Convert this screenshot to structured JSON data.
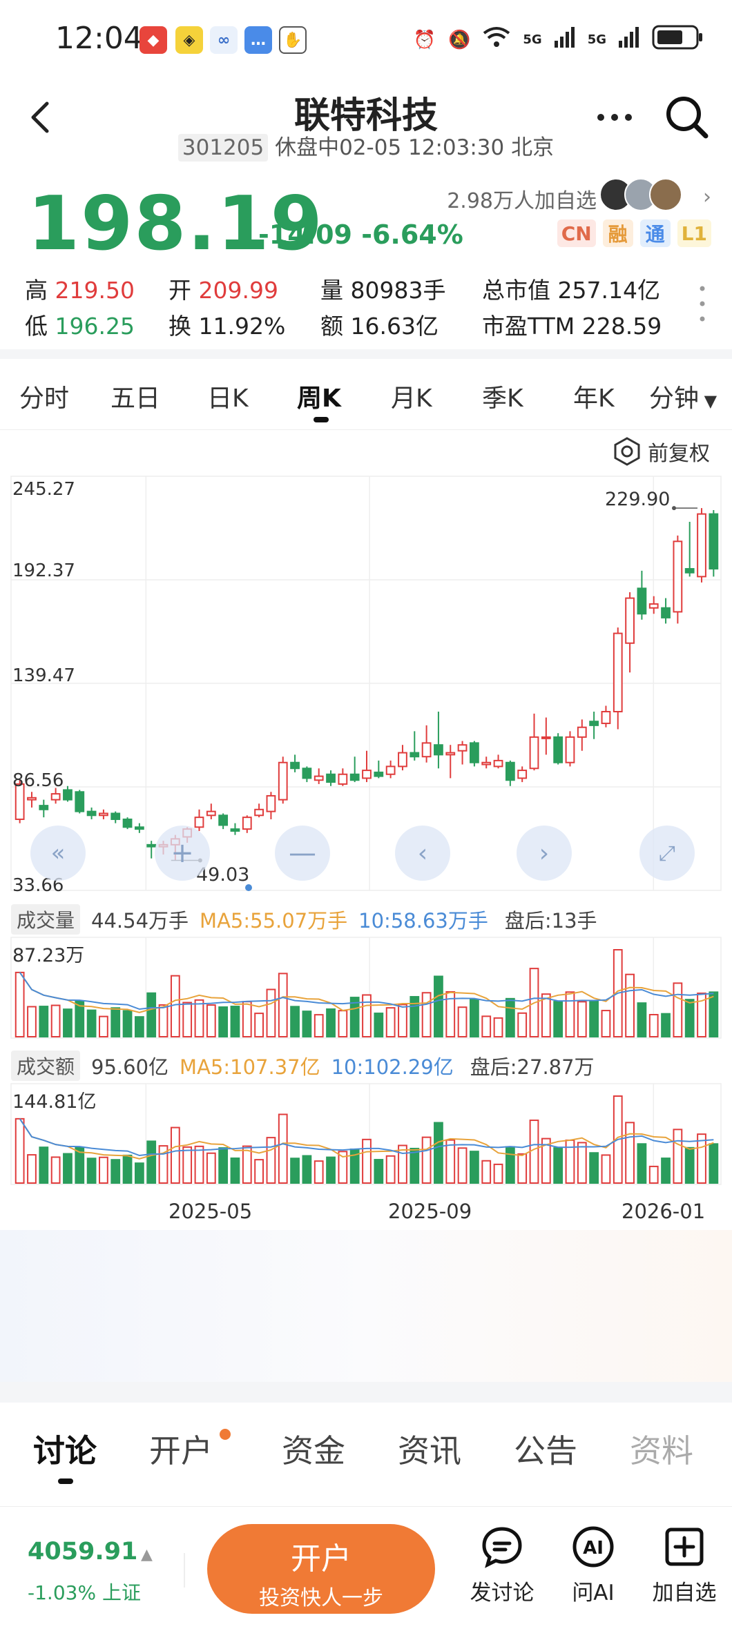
{
  "status": {
    "time": "12:04",
    "network": [
      "5G",
      "5G"
    ]
  },
  "header": {
    "title": "联特科技",
    "code": "301205",
    "status_line": "休盘中02-05 12:03:30 北京"
  },
  "quote": {
    "price": "198.19",
    "change": "-14.09",
    "change_pct": "-6.64%",
    "followers": "2.98万人加自选",
    "tags": [
      "CN",
      "融",
      "通",
      "L1"
    ],
    "stats": {
      "high_label": "高",
      "high": "219.50",
      "open_label": "开",
      "open": "209.99",
      "volume_label": "量",
      "volume": "80983手",
      "mcap_label": "总市值",
      "mcap": "257.14亿",
      "low_label": "低",
      "low": "196.25",
      "turnover_label": "换",
      "turnover": "11.92%",
      "amount_label": "额",
      "amount": "16.63亿",
      "pe_label": "市盈TTM",
      "pe": "228.59"
    }
  },
  "period_tabs": [
    "分时",
    "五日",
    "日K",
    "周K",
    "月K",
    "季K",
    "年K",
    "分钟"
  ],
  "active_period": "周K",
  "adjust_label": "前复权",
  "chart_data": {
    "type": "candlestick",
    "price_axis": [
      "245.27",
      "192.37",
      "139.47",
      "86.56",
      "33.66"
    ],
    "ylim": [
      33.66,
      245.27
    ],
    "max_marker": "229.90",
    "min_marker": "49.03",
    "x_ticks": [
      "2025-05",
      "2025-09",
      "2026-01"
    ],
    "candles": [
      {
        "o": 70,
        "c": 88,
        "h": 90,
        "l": 68
      },
      {
        "o": 80,
        "c": 81,
        "h": 84,
        "l": 76
      },
      {
        "o": 77,
        "c": 75,
        "h": 80,
        "l": 71
      },
      {
        "o": 80,
        "c": 83,
        "h": 86,
        "l": 78
      },
      {
        "o": 85,
        "c": 80,
        "h": 87,
        "l": 79
      },
      {
        "o": 84,
        "c": 74,
        "h": 85,
        "l": 73
      },
      {
        "o": 74,
        "c": 72,
        "h": 76,
        "l": 70
      },
      {
        "o": 72,
        "c": 73,
        "h": 75,
        "l": 70
      },
      {
        "o": 73,
        "c": 70,
        "h": 74,
        "l": 68
      },
      {
        "o": 70,
        "c": 66,
        "h": 71,
        "l": 65
      },
      {
        "o": 66,
        "c": 65,
        "h": 68,
        "l": 63
      },
      {
        "o": 57,
        "c": 56,
        "h": 59,
        "l": 50
      },
      {
        "o": 56,
        "c": 57,
        "h": 59,
        "l": 52
      },
      {
        "o": 57,
        "c": 60,
        "h": 62,
        "l": 49
      },
      {
        "o": 61,
        "c": 65,
        "h": 66,
        "l": 58
      },
      {
        "o": 66,
        "c": 71,
        "h": 75,
        "l": 64
      },
      {
        "o": 72,
        "c": 74,
        "h": 78,
        "l": 70
      },
      {
        "o": 72,
        "c": 67,
        "h": 73,
        "l": 65
      },
      {
        "o": 65,
        "c": 64,
        "h": 68,
        "l": 62
      },
      {
        "o": 65,
        "c": 71,
        "h": 72,
        "l": 63
      },
      {
        "o": 72,
        "c": 75,
        "h": 78,
        "l": 71
      },
      {
        "o": 74,
        "c": 82,
        "h": 84,
        "l": 70
      },
      {
        "o": 80,
        "c": 99,
        "h": 102,
        "l": 78
      },
      {
        "o": 99,
        "c": 96,
        "h": 103,
        "l": 94
      },
      {
        "o": 96,
        "c": 91,
        "h": 97,
        "l": 89
      },
      {
        "o": 90,
        "c": 92,
        "h": 96,
        "l": 88
      },
      {
        "o": 93,
        "c": 89,
        "h": 95,
        "l": 87
      },
      {
        "o": 88,
        "c": 93,
        "h": 96,
        "l": 87
      },
      {
        "o": 93,
        "c": 90,
        "h": 102,
        "l": 89
      },
      {
        "o": 91,
        "c": 95,
        "h": 105,
        "l": 89
      },
      {
        "o": 94,
        "c": 92,
        "h": 100,
        "l": 91
      },
      {
        "o": 93,
        "c": 97,
        "h": 100,
        "l": 91
      },
      {
        "o": 97,
        "c": 104,
        "h": 108,
        "l": 95
      },
      {
        "o": 104,
        "c": 102,
        "h": 115,
        "l": 100
      },
      {
        "o": 102,
        "c": 109,
        "h": 118,
        "l": 99
      },
      {
        "o": 108,
        "c": 103,
        "h": 125,
        "l": 96
      },
      {
        "o": 103,
        "c": 104,
        "h": 108,
        "l": 91
      },
      {
        "o": 105,
        "c": 108,
        "h": 110,
        "l": 98
      },
      {
        "o": 109,
        "c": 99,
        "h": 110,
        "l": 97
      },
      {
        "o": 98,
        "c": 99,
        "h": 102,
        "l": 96
      },
      {
        "o": 97,
        "c": 100,
        "h": 103,
        "l": 96
      },
      {
        "o": 99,
        "c": 90,
        "h": 100,
        "l": 87
      },
      {
        "o": 91,
        "c": 95,
        "h": 97,
        "l": 89
      },
      {
        "o": 96,
        "c": 112,
        "h": 124,
        "l": 95
      },
      {
        "o": 112,
        "c": 112,
        "h": 122,
        "l": 103
      },
      {
        "o": 112,
        "c": 99,
        "h": 114,
        "l": 98
      },
      {
        "o": 99,
        "c": 112,
        "h": 115,
        "l": 97
      },
      {
        "o": 112,
        "c": 117,
        "h": 121,
        "l": 105
      },
      {
        "o": 120,
        "c": 118,
        "h": 125,
        "l": 111
      },
      {
        "o": 119,
        "c": 125,
        "h": 128,
        "l": 117
      },
      {
        "o": 125,
        "c": 165,
        "h": 168,
        "l": 116
      },
      {
        "o": 160,
        "c": 183,
        "h": 186,
        "l": 145
      },
      {
        "o": 188,
        "c": 175,
        "h": 197,
        "l": 172
      },
      {
        "o": 178,
        "c": 180,
        "h": 184,
        "l": 175
      },
      {
        "o": 178,
        "c": 173,
        "h": 183,
        "l": 170
      },
      {
        "o": 176,
        "c": 212,
        "h": 215,
        "l": 170
      },
      {
        "o": 198,
        "c": 196,
        "h": 222,
        "l": 194
      },
      {
        "o": 194,
        "c": 226,
        "h": 229,
        "l": 191
      },
      {
        "o": 226,
        "c": 198,
        "h": 228,
        "l": 194
      }
    ],
    "volume_panel": {
      "label": "成交量",
      "value": "44.54万手",
      "ma5": "MA5:55.07万手",
      "ma10": "10:58.63万手",
      "after": "盘后:13手",
      "max_label": "87.23万"
    },
    "amount_panel": {
      "label": "成交额",
      "value": "95.60亿",
      "ma5": "MA5:107.37亿",
      "ma10": "10:102.29亿",
      "after": "盘后:27.87万",
      "max_label": "144.81亿"
    }
  },
  "bottom_tabs": [
    "讨论",
    "开户",
    "资金",
    "资讯",
    "公告",
    "资料"
  ],
  "active_bottom_tab": "讨论",
  "index": {
    "value": "4059.91",
    "change": "-1.03% 上证"
  },
  "open_button": {
    "title": "开户",
    "subtitle": "投资快人一步"
  },
  "actions": [
    "发讨论",
    "问AI",
    "加自选"
  ],
  "colors": {
    "up": "#e03c3c",
    "down": "#2a9d5c",
    "ma5": "#e8a33b",
    "ma10": "#4a8bd6",
    "accent": "#f07a35"
  }
}
